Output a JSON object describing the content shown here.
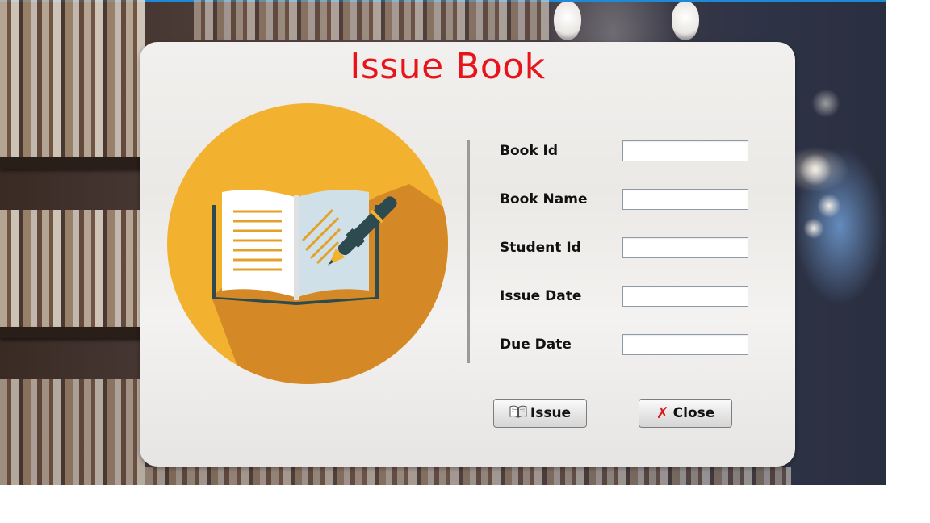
{
  "window": {
    "title": "Issue Book"
  },
  "form": {
    "fields": [
      {
        "label": "Book Id",
        "value": "",
        "placeholder": ""
      },
      {
        "label": "Book Name",
        "value": "",
        "placeholder": ""
      },
      {
        "label": "Student Id",
        "value": "",
        "placeholder": ""
      },
      {
        "label": "Issue Date",
        "value": "",
        "placeholder": ""
      },
      {
        "label": "Due Date",
        "value": "",
        "placeholder": ""
      }
    ]
  },
  "buttons": {
    "issue_label": "Issue",
    "issue_icon": "open-book-icon",
    "close_label": "Close",
    "close_icon": "close-icon"
  },
  "illustration": {
    "icon": "open-book-with-pen-icon"
  },
  "colors": {
    "title": "#e8141b",
    "circle": "#f2b22f",
    "circle_shadow": "#d58926",
    "book_cover": "#2c4a4f",
    "page_left": "#ffffff",
    "page_right": "#cfe0e8",
    "pen": "#2c4a4f",
    "close_x": "#d9161d",
    "accent_topline": "#1e88d9"
  }
}
